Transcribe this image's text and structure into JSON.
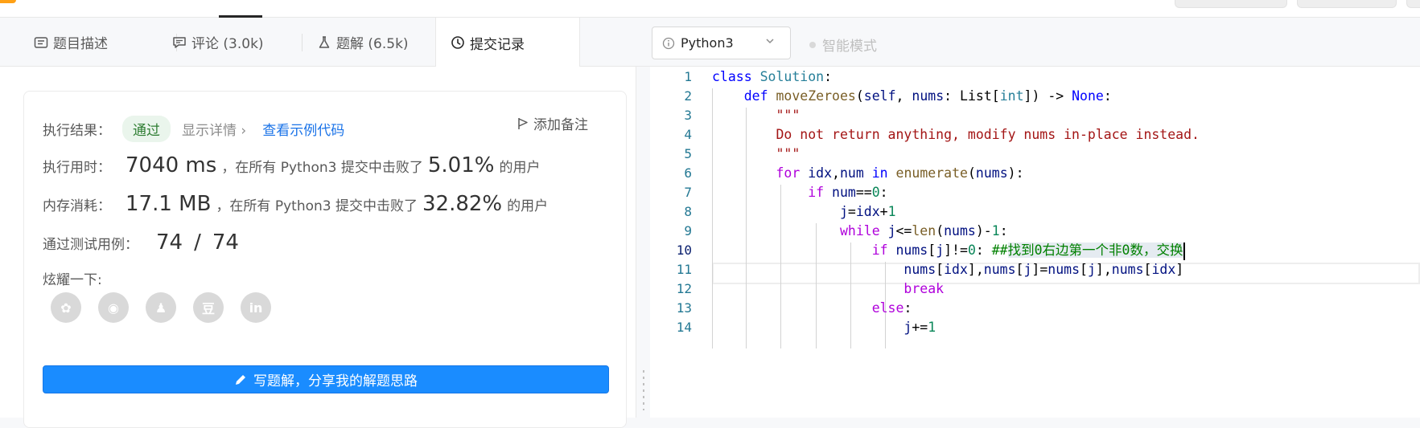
{
  "tabs": [
    {
      "label": "题目描述",
      "icon": "document-icon"
    },
    {
      "label": "评论 (3.0k)",
      "icon": "comment-icon"
    },
    {
      "label": "题解 (6.5k)",
      "icon": "flask-icon"
    },
    {
      "label": "提交记录",
      "icon": "clock-icon",
      "active": true
    }
  ],
  "result": {
    "label": "执行结果：",
    "status": "通过",
    "details": "显示详情 ›",
    "sample_code": "查看示例代码",
    "add_note": "添加备注"
  },
  "runtime": {
    "label": "执行用时：",
    "value": "7040 ms",
    "text1": "，在所有 Python3 提交中击败了",
    "percent": "5.01%",
    "text2": "的用户"
  },
  "memory": {
    "label": "内存消耗：",
    "value": "17.1 MB",
    "text1": "，在所有 Python3 提交中击败了",
    "percent": "32.82%",
    "text2": "的用户"
  },
  "tests": {
    "label": "通过测试用例：",
    "passed": "74",
    "slash": "/",
    "total": "74"
  },
  "share": {
    "label": "炫耀一下:",
    "icons": [
      "wechat-icon",
      "weibo-icon",
      "qq-icon",
      "douban-icon",
      "linkedin-icon"
    ],
    "glyphs": [
      "✿",
      "◉",
      "♟",
      "豆",
      "in"
    ]
  },
  "cta": {
    "label": "写题解，分享我的解题思路"
  },
  "editor": {
    "language": "Python3",
    "mode": "智能模式",
    "current_line": 10,
    "line_numbers": [
      "1",
      "2",
      "3",
      "4",
      "5",
      "6",
      "7",
      "8",
      "9",
      "10",
      "11",
      "12",
      "13",
      "14"
    ]
  },
  "colors": {
    "accent": "#1a8cff",
    "success_bg": "#eaf5ec",
    "success_text": "#2e7d32"
  }
}
